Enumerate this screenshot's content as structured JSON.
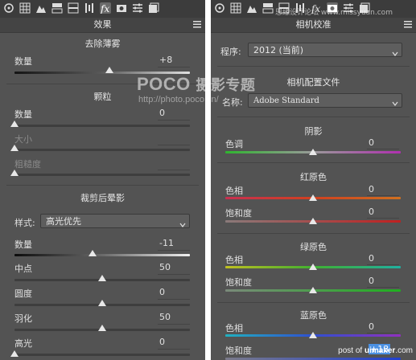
{
  "left": {
    "title": "效果",
    "dehaze": {
      "section": "去除薄雾",
      "amount_label": "数量",
      "amount_value": "+8"
    },
    "grain": {
      "section": "颗粒",
      "amount_label": "数量",
      "amount_value": "0",
      "size_label": "大小",
      "roughness_label": "粗糙度"
    },
    "vignette": {
      "section": "裁剪后晕影",
      "style_label": "样式:",
      "style_value": "高光优先",
      "amount_label": "数量",
      "amount_value": "-11",
      "midpoint_label": "中点",
      "midpoint_value": "50",
      "roundness_label": "圆度",
      "roundness_value": "0",
      "feather_label": "羽化",
      "feather_value": "50",
      "highlights_label": "高光",
      "highlights_value": "0"
    }
  },
  "right": {
    "title": "相机校准",
    "process_label": "程序:",
    "process_value": "2012 (当前)",
    "profile_section": "相机配置文件",
    "profile_label": "名称:",
    "profile_value": "Adobe Standard",
    "shadows": {
      "section": "阴影",
      "tint_label": "色调",
      "tint_value": "0"
    },
    "red": {
      "section": "红原色",
      "hue_label": "色相",
      "hue_value": "0",
      "sat_label": "饱和度",
      "sat_value": "0"
    },
    "green": {
      "section": "绿原色",
      "hue_label": "色相",
      "hue_value": "0",
      "sat_label": "饱和度",
      "sat_value": "0"
    },
    "blue": {
      "section": "蓝原色",
      "hue_label": "色相",
      "hue_value": "0",
      "sat_label": "饱和度",
      "sat_value": "+13"
    }
  },
  "watermarks": {
    "poco": "POCO",
    "poco_sub": "摄影专题",
    "poco_url": "http://photo.poco.cn/",
    "top": "思缘设计论坛 www.missyuan.com",
    "bottom_prefix": "post of",
    "bottom_brand": "uimaker",
    "bottom_suffix": ".com"
  },
  "slider_levels": {
    "dehaze_amount": 8,
    "grain_amount": 0,
    "grain_size": 0,
    "grain_roughness": 0,
    "vignette_amount": -11,
    "midpoint": 50,
    "roundness": 0,
    "feather": 50,
    "highlights": 0,
    "shadows_tint": 0,
    "red_hue": 0,
    "red_sat": 0,
    "green_hue": 0,
    "green_sat": 0,
    "blue_hue": 0,
    "blue_sat": 13
  },
  "icons": [
    "histogram-icon",
    "grid-icon",
    "mountain-icon",
    "split-icon",
    "panel-icon",
    "lens-icon",
    "fx-icon",
    "camera-icon",
    "sliders-icon",
    "presets-icon"
  ],
  "colors": {
    "panel_bg": "#535353",
    "toolbar_bg": "#3c3c3c",
    "accent": "#4a90e2"
  }
}
